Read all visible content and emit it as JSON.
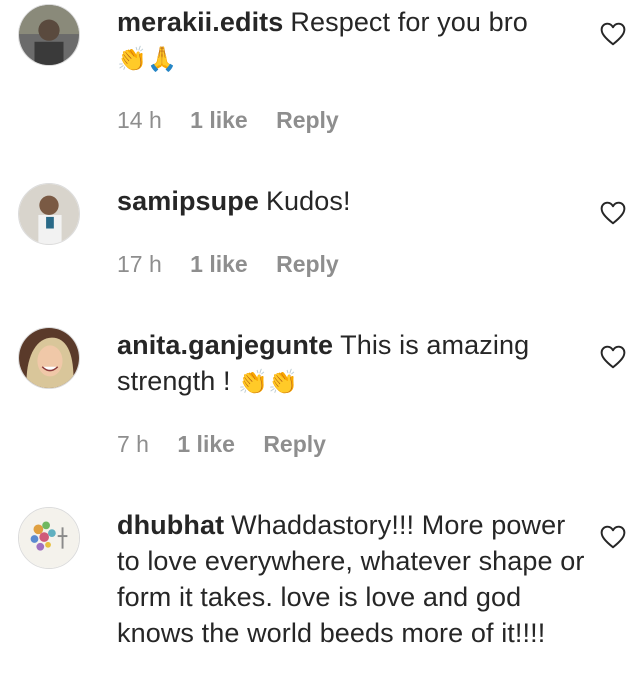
{
  "comments": [
    {
      "username": "merakii.edits",
      "text": "Respect for you bro",
      "emoji": "👏🙏",
      "time": "14 h",
      "likes": "1 like",
      "reply": "Reply"
    },
    {
      "username": "samipsupe",
      "text": "Kudos!",
      "emoji": "",
      "time": "17 h",
      "likes": "1 like",
      "reply": "Reply"
    },
    {
      "username": "anita.ganjegunte",
      "text": "This is amazing strength !",
      "emoji": "👏👏",
      "time": "7 h",
      "likes": "1 like",
      "reply": "Reply"
    },
    {
      "username": "dhubhat",
      "text": "Whaddastory!!! More power to love everywhere, whatever shape or form it takes. love is love and god knows the world beeds more of it!!!!",
      "emoji": "",
      "time": "",
      "likes": "",
      "reply": ""
    }
  ],
  "icons": {
    "like": "heart-outline-icon",
    "avatar": "user-avatar"
  },
  "colors": {
    "text": "#262626",
    "meta": "#8e8e8e",
    "border": "#dbdbdb"
  }
}
